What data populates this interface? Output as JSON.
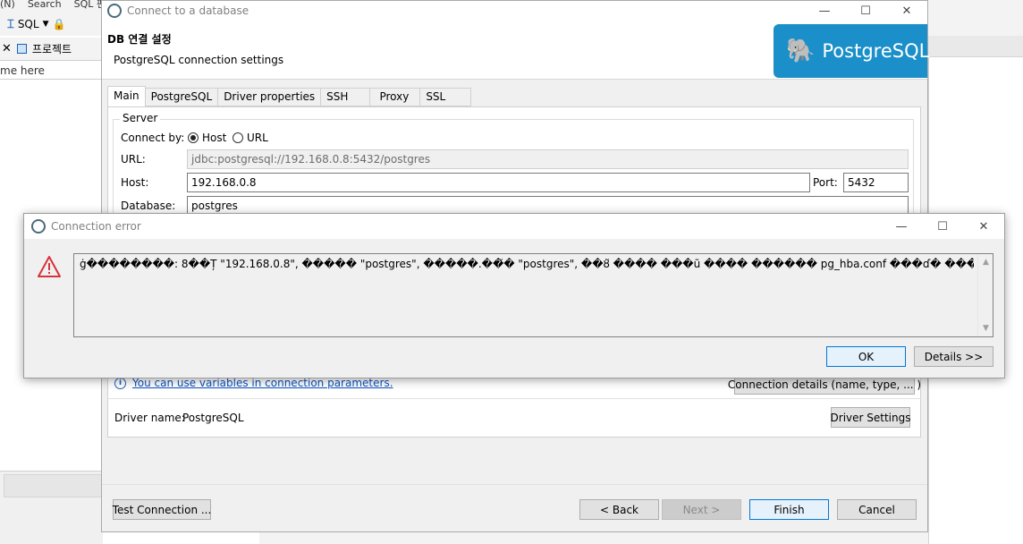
{
  "background": {
    "menu": [
      "(N)",
      "Search",
      "SQL 편"
    ],
    "toolbar": {
      "sql_label": "SQL"
    },
    "project_tab": "프로젝트",
    "filter_placeholder": "me here"
  },
  "connect_dialog": {
    "window_title": "Connect to a database",
    "heading": "DB 연결 설정",
    "subheading": "PostgreSQL connection settings",
    "banner_text": "PostgreSQL",
    "tabs": [
      {
        "label": "Main",
        "active": true
      },
      {
        "label": "PostgreSQL",
        "active": false
      },
      {
        "label": "Driver properties",
        "active": false
      },
      {
        "label": "SSH",
        "active": false
      },
      {
        "label": "Proxy",
        "active": false
      },
      {
        "label": "SSL",
        "active": false
      }
    ],
    "server_group_label": "Server",
    "connect_by_label": "Connect by:",
    "connect_by_host": "Host",
    "connect_by_url": "URL",
    "url_label": "URL:",
    "url_value": "jdbc:postgresql://192.168.0.8:5432/postgres",
    "host_label": "Host:",
    "host_value": "192.168.0.8",
    "port_label": "Port:",
    "port_value": "5432",
    "database_label": "Database:",
    "database_value": "postgres",
    "variables_link": "You can use variables in connection parameters.",
    "connection_details_button": "Connection details (name, type, ... )",
    "driver_name_label": "Driver name:",
    "driver_name_value": "PostgreSQL",
    "driver_settings_button": "Driver Settings",
    "footer": {
      "test_connection": "Test Connection ...",
      "back": "< Back",
      "next": "Next >",
      "finish": "Finish",
      "cancel": "Cancel"
    }
  },
  "error_dialog": {
    "window_title": "Connection error",
    "message": "ġ��������: 8��Ț \"192.168.0.8\", ����� \"postgres\", �����.��̌� \"postgres\", ��ȣ̃ ���� ���ũ ���� ������ pg_hba.conf ���ɗ� �����Ɵ�.",
    "ok_button": "OK",
    "details_button": "Details >>"
  }
}
